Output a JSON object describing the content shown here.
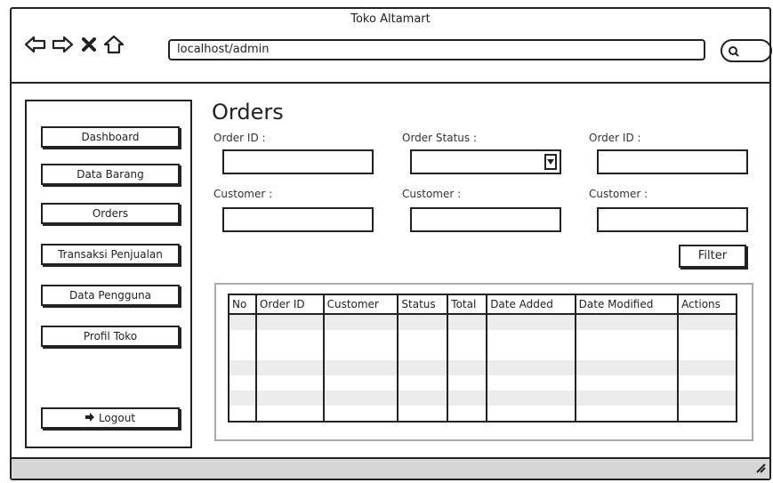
{
  "window": {
    "title": "Toko Altamart"
  },
  "browser": {
    "url": "localhost/admin"
  },
  "sidebar": {
    "items": [
      {
        "label": "Dashboard"
      },
      {
        "label": "Data Barang"
      },
      {
        "label": "Orders"
      },
      {
        "label": "Transaksi Penjualan"
      },
      {
        "label": "Data Pengguna"
      },
      {
        "label": "Profil Toko"
      }
    ],
    "logout_label": "Logout"
  },
  "main": {
    "title": "Orders",
    "filters": {
      "row1": [
        {
          "label": "Order ID :",
          "value": ""
        },
        {
          "label": "Order Status :",
          "value": ""
        },
        {
          "label": "Order ID :",
          "value": ""
        }
      ],
      "row2": [
        {
          "label": "Customer :",
          "value": ""
        },
        {
          "label": "Customer :",
          "value": ""
        },
        {
          "label": "Customer :",
          "value": ""
        }
      ]
    },
    "filter_button": "Filter",
    "table": {
      "columns": [
        "No",
        "Order ID",
        "Customer",
        "Status",
        "Total",
        "Date Added",
        "Date Modified",
        "Actions"
      ],
      "rows": []
    }
  }
}
